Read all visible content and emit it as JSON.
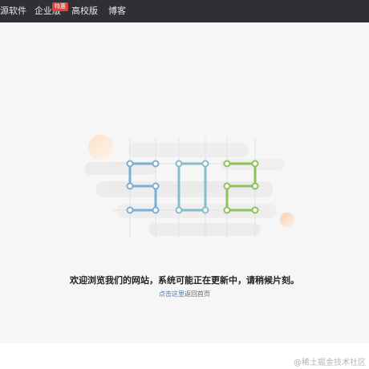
{
  "nav": {
    "items": [
      {
        "label": "源软件"
      },
      {
        "label": "企业版"
      },
      {
        "label": "高校版"
      },
      {
        "label": "博客"
      }
    ],
    "badge": "特惠"
  },
  "error": {
    "code": "502",
    "message": "欢迎浏览我们的网站，系统可能正在更新中，请稍候片刻。",
    "link_text": "点击这里",
    "link_suffix": "返回首页"
  },
  "watermark": "@稀土掘金技术社区",
  "colors": {
    "topbar": "#2e3035",
    "digit_5": "#7aaed6",
    "digit_0": "#86bdca",
    "digit_2": "#8cc25a",
    "link": "#3f7fc4"
  }
}
